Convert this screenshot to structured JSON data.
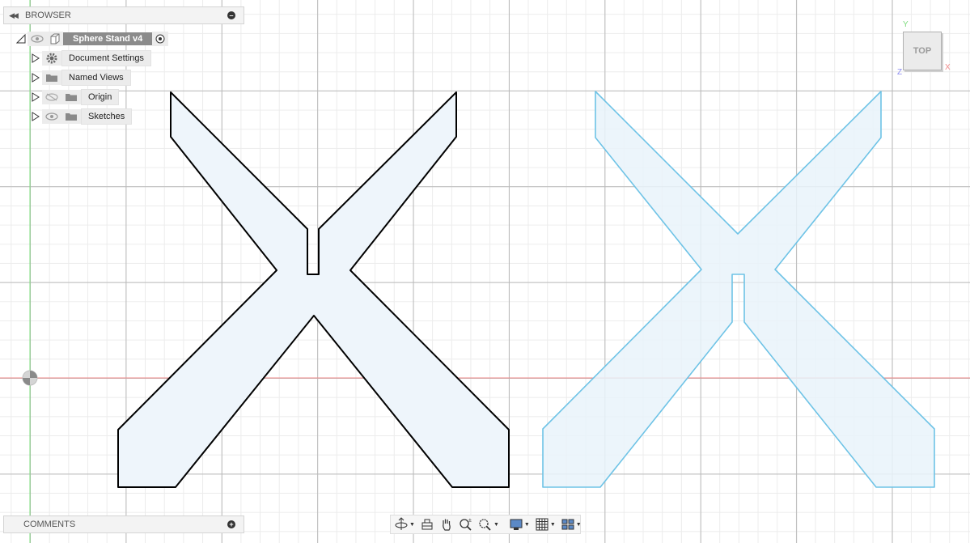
{
  "browser": {
    "title": "BROWSER",
    "root": {
      "label": "Sphere Stand v4"
    },
    "items": [
      {
        "label": "Document Settings",
        "icon": "gear-icon"
      },
      {
        "label": "Named Views",
        "icon": "folder-icon"
      },
      {
        "label": "Origin",
        "icon": "folder-icon",
        "visible": false
      },
      {
        "label": "Sketches",
        "icon": "folder-icon",
        "visible": true
      }
    ]
  },
  "comments": {
    "title": "COMMENTS"
  },
  "viewcube": {
    "face": "TOP",
    "x_label": "X",
    "y_label": "Y",
    "z_label": "Z"
  },
  "colors": {
    "selected_outline": "#000000",
    "sketch_outline": "#6ec3e6",
    "profile_fill": "#eaf4fb",
    "x_axis": "#ef8a8a",
    "y_axis": "#7fdc7f"
  },
  "toolbar": {
    "items": [
      "orbit-icon",
      "look-at-icon",
      "pan-icon",
      "zoom-icon",
      "fit-icon",
      "display-settings-icon",
      "grid-settings-icon",
      "viewports-icon"
    ]
  }
}
